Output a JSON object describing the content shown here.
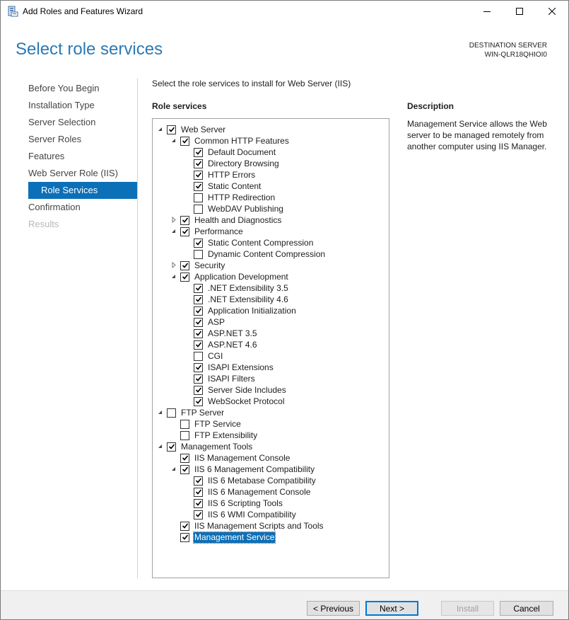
{
  "window": {
    "title": "Add Roles and Features Wizard",
    "icons": {
      "app": "server-manager-icon",
      "minimize": "minimize-icon",
      "maximize": "maximize-icon",
      "close": "close-icon"
    }
  },
  "header": {
    "title": "Select role services",
    "dest_label": "DESTINATION SERVER",
    "dest_server": "WIN-QLR18QHIOI0"
  },
  "nav": [
    {
      "label": "Before You Begin",
      "state": "normal"
    },
    {
      "label": "Installation Type",
      "state": "normal"
    },
    {
      "label": "Server Selection",
      "state": "normal"
    },
    {
      "label": "Server Roles",
      "state": "normal"
    },
    {
      "label": "Features",
      "state": "normal"
    },
    {
      "label": "Web Server Role (IIS)",
      "state": "normal"
    },
    {
      "label": "Role Services",
      "state": "active"
    },
    {
      "label": "Confirmation",
      "state": "normal"
    },
    {
      "label": "Results",
      "state": "disabled"
    }
  ],
  "intro": "Select the role services to install for Web Server (IIS)",
  "role_services_label": "Role services",
  "tree": [
    {
      "label": "Web Server",
      "level": 0,
      "checked": true,
      "expander": "expanded"
    },
    {
      "label": "Common HTTP Features",
      "level": 1,
      "checked": true,
      "expander": "expanded"
    },
    {
      "label": "Default Document",
      "level": 2,
      "checked": true,
      "expander": "none"
    },
    {
      "label": "Directory Browsing",
      "level": 2,
      "checked": true,
      "expander": "none"
    },
    {
      "label": "HTTP Errors",
      "level": 2,
      "checked": true,
      "expander": "none"
    },
    {
      "label": "Static Content",
      "level": 2,
      "checked": true,
      "expander": "none"
    },
    {
      "label": "HTTP Redirection",
      "level": 2,
      "checked": false,
      "expander": "none"
    },
    {
      "label": "WebDAV Publishing",
      "level": 2,
      "checked": false,
      "expander": "none"
    },
    {
      "label": "Health and Diagnostics",
      "level": 1,
      "checked": true,
      "expander": "collapsed"
    },
    {
      "label": "Performance",
      "level": 1,
      "checked": true,
      "expander": "expanded"
    },
    {
      "label": "Static Content Compression",
      "level": 2,
      "checked": true,
      "expander": "none"
    },
    {
      "label": "Dynamic Content Compression",
      "level": 2,
      "checked": false,
      "expander": "none"
    },
    {
      "label": "Security",
      "level": 1,
      "checked": true,
      "expander": "collapsed"
    },
    {
      "label": "Application Development",
      "level": 1,
      "checked": true,
      "expander": "expanded"
    },
    {
      "label": ".NET Extensibility 3.5",
      "level": 2,
      "checked": true,
      "expander": "none"
    },
    {
      "label": ".NET Extensibility 4.6",
      "level": 2,
      "checked": true,
      "expander": "none"
    },
    {
      "label": "Application Initialization",
      "level": 2,
      "checked": true,
      "expander": "none"
    },
    {
      "label": "ASP",
      "level": 2,
      "checked": true,
      "expander": "none"
    },
    {
      "label": "ASP.NET 3.5",
      "level": 2,
      "checked": true,
      "expander": "none"
    },
    {
      "label": "ASP.NET 4.6",
      "level": 2,
      "checked": true,
      "expander": "none"
    },
    {
      "label": "CGI",
      "level": 2,
      "checked": false,
      "expander": "none"
    },
    {
      "label": "ISAPI Extensions",
      "level": 2,
      "checked": true,
      "expander": "none"
    },
    {
      "label": "ISAPI Filters",
      "level": 2,
      "checked": true,
      "expander": "none"
    },
    {
      "label": "Server Side Includes",
      "level": 2,
      "checked": true,
      "expander": "none"
    },
    {
      "label": "WebSocket Protocol",
      "level": 2,
      "checked": true,
      "expander": "none"
    },
    {
      "label": "FTP Server",
      "level": 0,
      "checked": false,
      "expander": "expanded"
    },
    {
      "label": "FTP Service",
      "level": 1,
      "checked": false,
      "expander": "none"
    },
    {
      "label": "FTP Extensibility",
      "level": 1,
      "checked": false,
      "expander": "none"
    },
    {
      "label": "Management Tools",
      "level": 0,
      "checked": true,
      "expander": "expanded"
    },
    {
      "label": "IIS Management Console",
      "level": 1,
      "checked": true,
      "expander": "none"
    },
    {
      "label": "IIS 6 Management Compatibility",
      "level": 1,
      "checked": true,
      "expander": "expanded"
    },
    {
      "label": "IIS 6 Metabase Compatibility",
      "level": 2,
      "checked": true,
      "expander": "none"
    },
    {
      "label": "IIS 6 Management Console",
      "level": 2,
      "checked": true,
      "expander": "none"
    },
    {
      "label": "IIS 6 Scripting Tools",
      "level": 2,
      "checked": true,
      "expander": "none"
    },
    {
      "label": "IIS 6 WMI Compatibility",
      "level": 2,
      "checked": true,
      "expander": "none"
    },
    {
      "label": "IIS Management Scripts and Tools",
      "level": 1,
      "checked": true,
      "expander": "none"
    },
    {
      "label": "Management Service",
      "level": 1,
      "checked": true,
      "expander": "none",
      "selected": true
    }
  ],
  "description": {
    "label": "Description",
    "text": "Management Service allows the Web server to be managed remotely from another computer using IIS Manager."
  },
  "buttons": {
    "previous": "< Previous",
    "next": "Next >",
    "install": "Install",
    "cancel": "Cancel"
  }
}
